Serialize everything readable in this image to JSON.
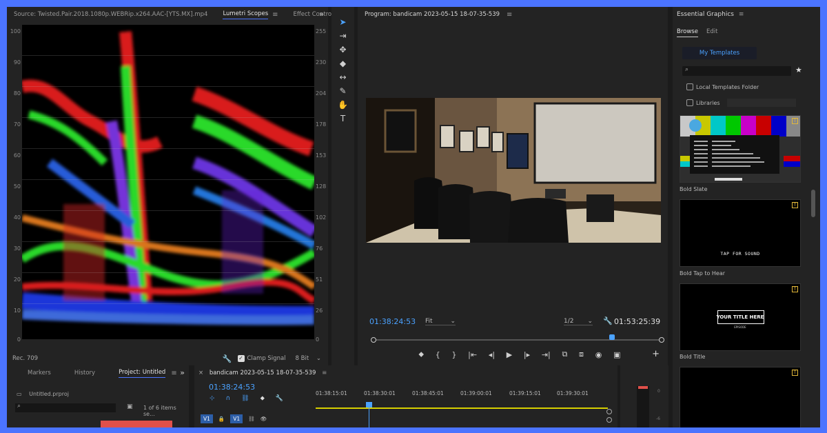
{
  "source_panel": {
    "tabs": [
      "Source: Twisted.Pair.2018.1080p.WEBRip.x264.AAC-[YTS.MX].mp4",
      "Lumetri Scopes",
      "Effect Controls"
    ],
    "active_tab": "Lumetri Scopes",
    "more_icon": "double-chevron-right-icon"
  },
  "scope": {
    "left_ticks": [
      "100",
      "90",
      "80",
      "70",
      "60",
      "50",
      "40",
      "30",
      "20",
      "10",
      "0"
    ],
    "right_ticks": [
      "255",
      "230",
      "204",
      "178",
      "153",
      "128",
      "102",
      "76",
      "51",
      "26",
      "0"
    ],
    "color_space": "Rec. 709",
    "clamp_label": "Clamp Signal",
    "bit_depth": "8 Bit"
  },
  "program": {
    "title": "Program: bandicam 2023-05-15 18-07-35-539",
    "timecode": "01:38:24:53",
    "fit": "Fit",
    "resolution": "1/2",
    "duration": "01:53:25:39"
  },
  "essential_graphics": {
    "title": "Essential Graphics",
    "tabs": [
      "Browse",
      "Edit"
    ],
    "active_tab": "Browse",
    "my_templates": "My Templates",
    "local_templates": "Local Templates Folder",
    "libraries": "Libraries",
    "templates": [
      {
        "name": "Bold Slate",
        "overlay": ""
      },
      {
        "name": "Bold Tap to Hear",
        "overlay": "TAP FOR SOUND"
      },
      {
        "name": "Bold Title",
        "overlay": "YOUR TITLE HERE",
        "sub": "EPISODE"
      }
    ]
  },
  "project": {
    "tabs": [
      "Markers",
      "History",
      "Project: Untitled"
    ],
    "active_tab": "Project: Untitled",
    "file": "Untitled.prproj",
    "items": "1 of 6 items se..."
  },
  "timeline": {
    "title": "bandicam 2023-05-15 18-07-35-539",
    "timecode": "01:38:24:53",
    "ruler": [
      "01:38:15:01",
      "01:38:30:01",
      "01:38:45:01",
      "01:39:00:01",
      "01:39:15:01",
      "01:39:30:01"
    ],
    "track_source": "V1",
    "track_target": "V1"
  },
  "meters": {
    "ticks": [
      "0",
      "-6"
    ]
  },
  "colors": {
    "accent": "#4ba2ff",
    "frame": "#4b74ff",
    "panel": "#232323",
    "slate_badge": "#e4b93a"
  }
}
